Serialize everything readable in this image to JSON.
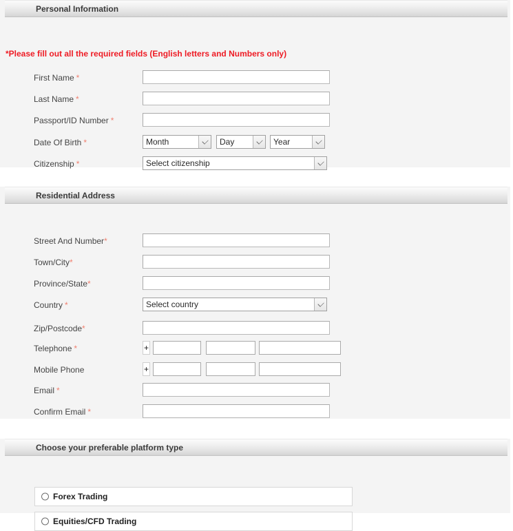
{
  "notice": "*Please fill out all the required fields (English letters and Numbers only)",
  "required_mark": "*",
  "phone_prefix": "+",
  "sections": {
    "personal": {
      "title": "Personal Information",
      "fields": {
        "first_name": "First Name",
        "last_name": "Last Name",
        "passport": "Passport/ID Number",
        "dob": "Date Of Birth",
        "citizenship": "Citizenship"
      },
      "values": {
        "first_name": "",
        "last_name": "",
        "passport": "",
        "dob_month": "Month",
        "dob_day": "Day",
        "dob_year": "Year",
        "citizenship": "Select citizenship"
      }
    },
    "address": {
      "title": "Residential Address",
      "fields": {
        "street": "Street And Number",
        "town": "Town/City",
        "province": "Province/State",
        "country": "Country",
        "zip": "Zip/Postcode",
        "telephone": "Telephone",
        "mobile": "Mobile Phone",
        "email": "Email",
        "confirm_email": "Confirm Email"
      },
      "values": {
        "street": "",
        "town": "",
        "province": "",
        "country": "Select country",
        "zip": "",
        "telephone_code": "",
        "telephone_area": "",
        "telephone_number": "",
        "mobile_code": "",
        "mobile_area": "",
        "mobile_number": "",
        "email": "",
        "confirm_email": ""
      }
    },
    "platform": {
      "title": "Choose your preferable platform type",
      "options": [
        {
          "label": "Forex Trading",
          "selected": false
        },
        {
          "label": "Equities/CFD Trading",
          "selected": false
        }
      ]
    }
  },
  "colors": {
    "notice_red": "#ee1b24",
    "required_asterisk": "#f08070",
    "panel_bg": "#f4f4f4"
  }
}
